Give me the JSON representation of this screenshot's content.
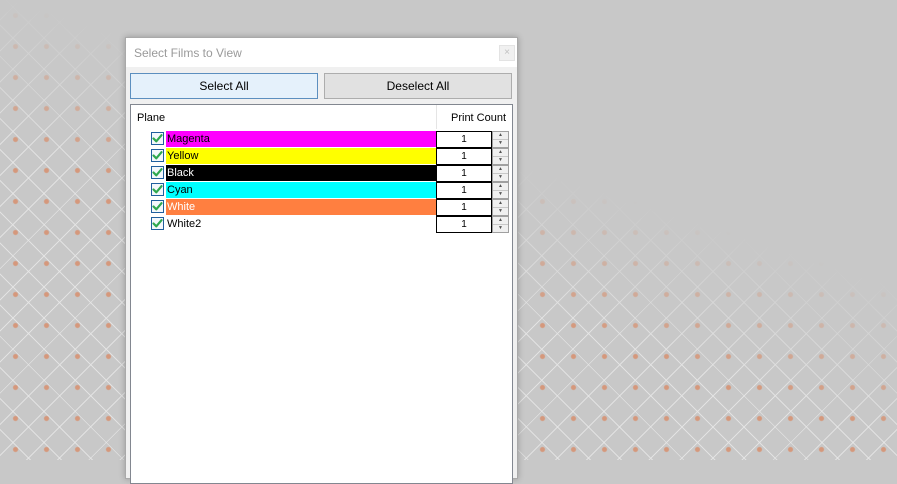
{
  "dialog": {
    "title": "Select Films to View",
    "close_glyph": "×"
  },
  "buttons": {
    "select_all": "Select All",
    "deselect_all": "Deselect All"
  },
  "table": {
    "headers": {
      "plane": "Plane",
      "print_count": "Print Count"
    },
    "rows": [
      {
        "label": "Magenta",
        "checked": true,
        "print_count": "1",
        "color": "#ff00ff",
        "text_color": "#000000"
      },
      {
        "label": "Yellow",
        "checked": true,
        "print_count": "1",
        "color": "#ffff00",
        "text_color": "#000000"
      },
      {
        "label": "Black",
        "checked": true,
        "print_count": "1",
        "color": "#000000",
        "text_color": "#ffffff"
      },
      {
        "label": "Cyan",
        "checked": true,
        "print_count": "1",
        "color": "#00ffff",
        "text_color": "#000000"
      },
      {
        "label": "White",
        "checked": true,
        "print_count": "1",
        "color": "#ff7f40",
        "text_color": "#ffffff"
      },
      {
        "label": "White2",
        "checked": true,
        "print_count": "1",
        "color": "#ffffff",
        "text_color": "#000000"
      }
    ]
  },
  "icons": {
    "checkbox": "check-icon",
    "spin_up": "▲",
    "spin_down": "▼"
  }
}
